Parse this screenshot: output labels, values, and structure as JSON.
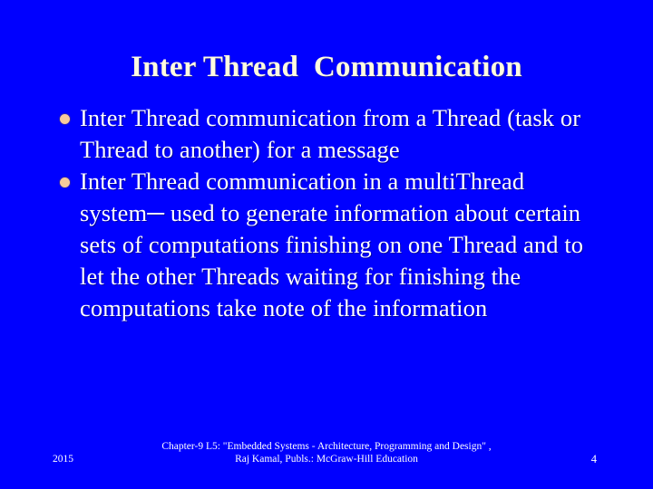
{
  "slide": {
    "background_color": "#0000FF",
    "title": "Inter Thread  Communication",
    "title_color": "#FFFBE0",
    "body_text_color": "#FFFFFF",
    "bullet_marker_color": "#F7CB9C",
    "bullets": [
      {
        "marker": "filled-circle-bullet",
        "text": "Inter Thread communication from a Thread (task or  Thread to another) for a message"
      },
      {
        "marker": "filled-circle-bullet",
        "text": "Inter Thread communication in a multiThread system─ used to generate information about certain sets of computations finishing on one Thread and to let the other Threads waiting for finishing the computations take note of the information"
      }
    ]
  },
  "footer": {
    "year": "2015",
    "citation_line1": "Chapter-9 L5: \"Embedded Systems - Architecture, Programming and Design\" ,",
    "citation_line2": "Raj Kamal, Publs.: McGraw-Hill Education",
    "page_number": "4"
  }
}
